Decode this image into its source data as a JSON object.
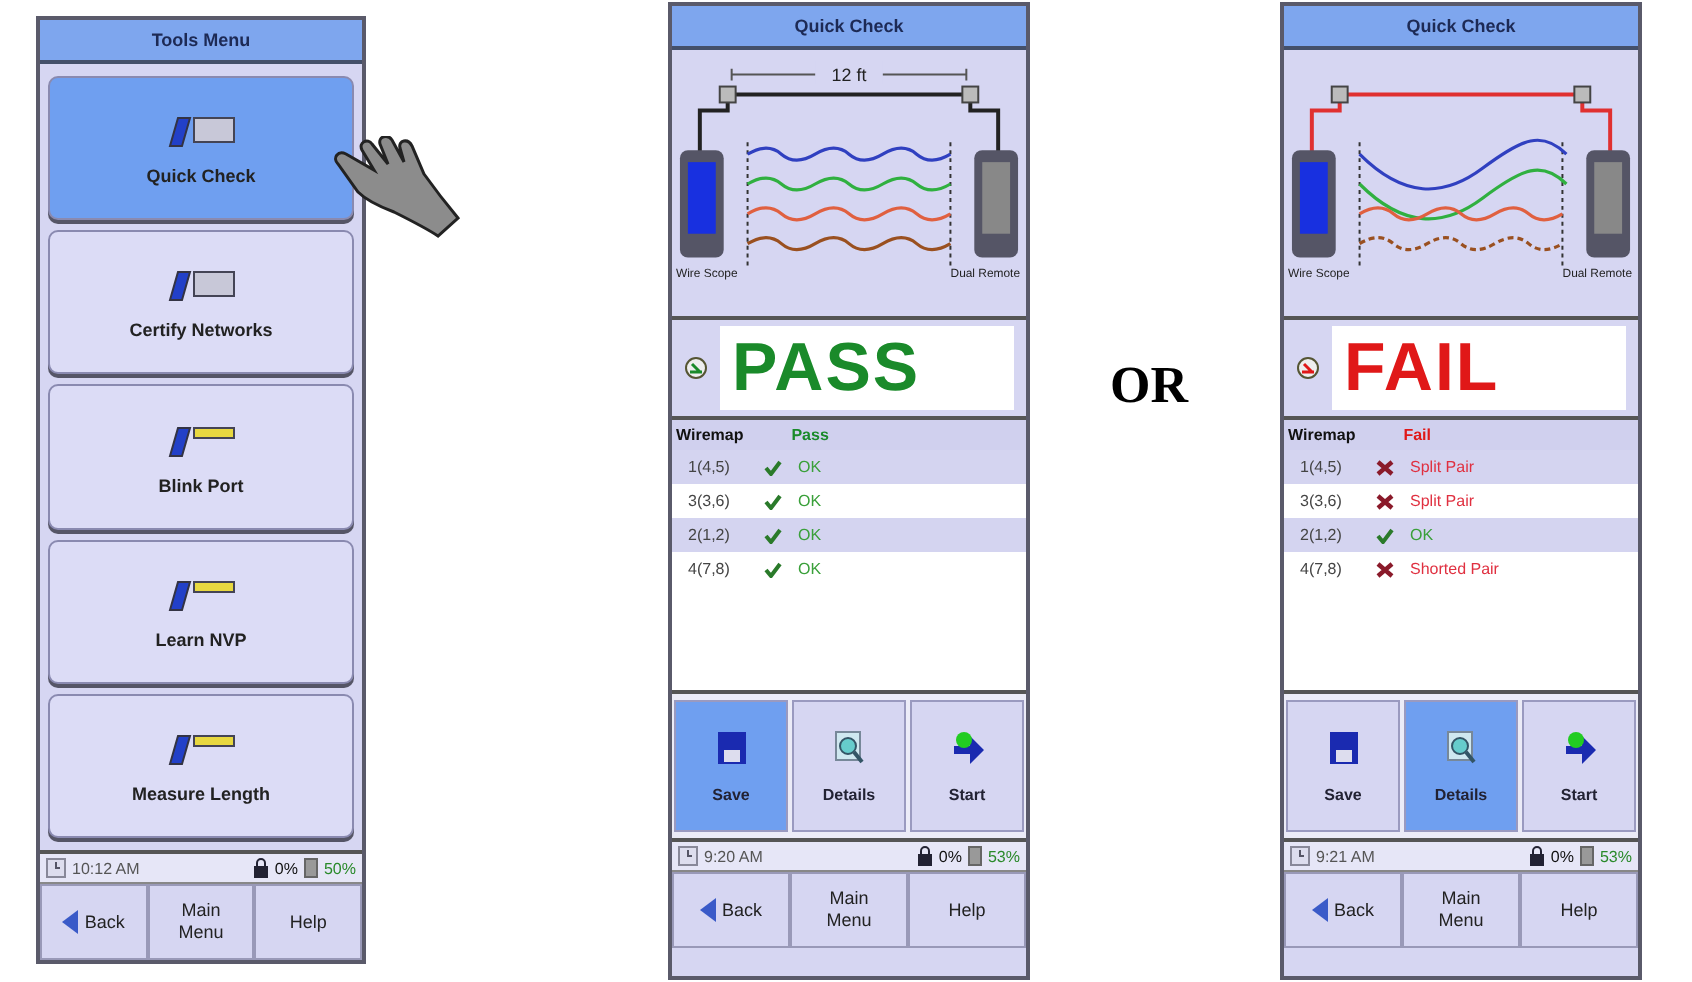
{
  "tools_menu": {
    "title": "Tools Menu",
    "items": [
      {
        "label": "Quick Check",
        "selected": true
      },
      {
        "label": "Certify Networks",
        "selected": false
      },
      {
        "label": "Blink Port",
        "selected": false
      },
      {
        "label": "Learn NVP",
        "selected": false
      },
      {
        "label": "Measure Length",
        "selected": false
      }
    ],
    "status": {
      "time": "10:12 AM",
      "remote": "0%",
      "battery": "50%"
    },
    "nav": [
      {
        "label": "Back"
      },
      {
        "label": "Main Menu"
      },
      {
        "label": "Help"
      }
    ]
  },
  "separator": "OR",
  "quick_checks": [
    {
      "title": "Quick Check",
      "length": "12 ft",
      "left_device": "Wire Scope",
      "right_device": "Dual Remote",
      "result": "PASS",
      "passed": true,
      "wiremap_header": "Wiremap",
      "wiremap_status": "Pass",
      "rows": [
        {
          "pair": "1(4,5)",
          "kind": "ok",
          "status": "OK"
        },
        {
          "pair": "3(3,6)",
          "kind": "ok",
          "status": "OK"
        },
        {
          "pair": "2(1,2)",
          "kind": "ok",
          "status": "OK"
        },
        {
          "pair": "4(7,8)",
          "kind": "ok",
          "status": "OK"
        }
      ],
      "actions": [
        {
          "label": "Save",
          "selected": true
        },
        {
          "label": "Details",
          "selected": false
        },
        {
          "label": "Start",
          "selected": false
        }
      ],
      "status": {
        "time": "9:20 AM",
        "remote": "0%",
        "battery": "53%"
      },
      "nav": [
        {
          "label": "Back"
        },
        {
          "label": "Main Menu"
        },
        {
          "label": "Help"
        }
      ]
    },
    {
      "title": "Quick Check",
      "left_device": "Wire Scope",
      "right_device": "Dual Remote",
      "result": "FAIL",
      "passed": false,
      "wiremap_header": "Wiremap",
      "wiremap_status": "Fail",
      "rows": [
        {
          "pair": "1(4,5)",
          "kind": "fault",
          "status": "Split Pair"
        },
        {
          "pair": "3(3,6)",
          "kind": "fault",
          "status": "Split Pair"
        },
        {
          "pair": "2(1,2)",
          "kind": "ok",
          "status": "OK"
        },
        {
          "pair": "4(7,8)",
          "kind": "fault",
          "status": "Shorted Pair"
        }
      ],
      "actions": [
        {
          "label": "Save",
          "selected": false
        },
        {
          "label": "Details",
          "selected": true
        },
        {
          "label": "Start",
          "selected": false
        }
      ],
      "status": {
        "time": "9:21 AM",
        "remote": "0%",
        "battery": "53%"
      },
      "nav": [
        {
          "label": "Back"
        },
        {
          "label": "Main Menu"
        },
        {
          "label": "Help"
        }
      ]
    }
  ]
}
